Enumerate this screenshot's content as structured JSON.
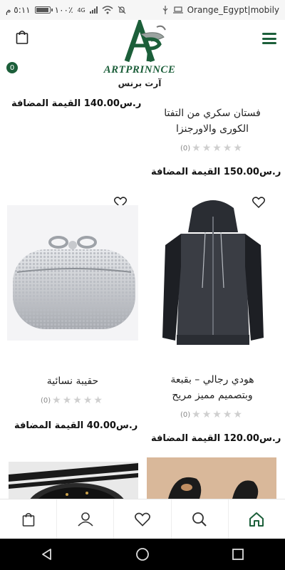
{
  "status_bar": {
    "time": "٥:١١ م",
    "battery": "١٠٠٪",
    "network_type": "4G",
    "carrier": "Orange_Egypt|mobily",
    "battery_level": 1.0
  },
  "header": {
    "cart_count": "0",
    "logo_text_en": "ARTPRINNCE",
    "logo_text_ar": "آرت برنس",
    "brand_color": "#1c5f3a"
  },
  "products": {
    "row0": {
      "left_price": "ر.س140.00 القيمة المضافة",
      "right_name_line1": "فستان سكري من التفتا",
      "right_name_line2": "الكورى والاورجنزا",
      "right_rating_count": "(0)",
      "right_price": "ر.س150.00 القيمة المضافة"
    },
    "row1": {
      "left": {
        "name": "حقيبة نسائية",
        "rating_count": "(0)",
        "price": "ر.س40.00 القيمة المضافة",
        "image": "silver-clutch-bag"
      },
      "right": {
        "name_line1": "هودي رجالي – بقبعة",
        "name_line2": "وبتصميم مميز مريح",
        "rating_count": "(0)",
        "price": "ر.س120.00 القيمة المضافة",
        "image": "black-hoodie"
      }
    }
  },
  "bottom_nav": {
    "items": [
      "cart-icon",
      "user-icon",
      "heart-icon",
      "search-icon",
      "home-icon"
    ],
    "active": "home-icon"
  },
  "system_nav": [
    "back-icon",
    "home-circle-icon",
    "recents-icon"
  ]
}
